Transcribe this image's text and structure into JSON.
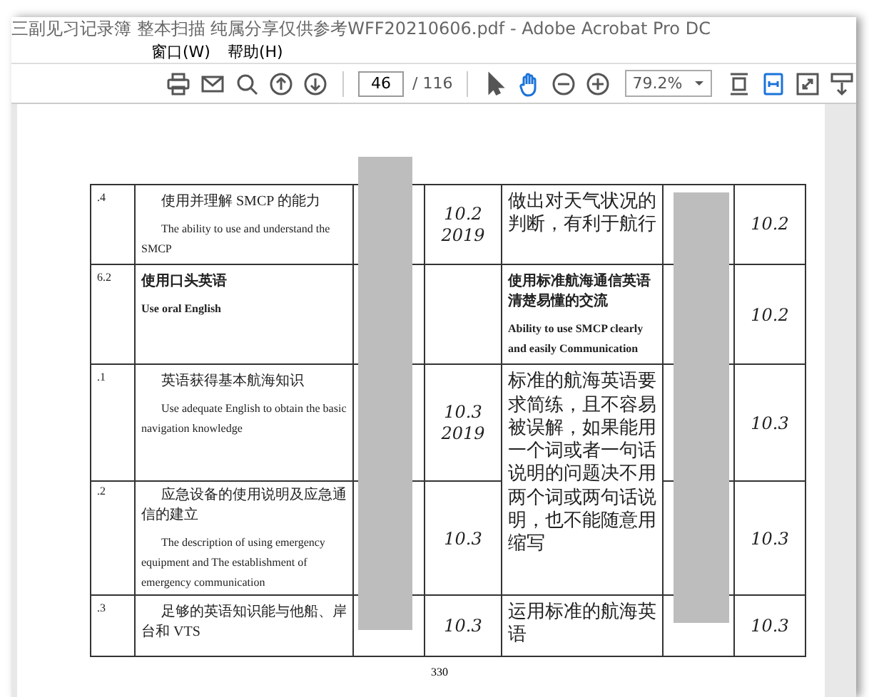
{
  "window": {
    "title": "三副见习记录簿  整本扫描  纯属分享仅供参考WFF20210606.pdf - Adobe Acrobat Pro DC"
  },
  "menu": [
    "窗口(W)",
    "帮助(H)"
  ],
  "toolbar": {
    "tools_left": [
      {
        "kind": "print",
        "selected": false
      },
      {
        "kind": "mail",
        "selected": false
      },
      {
        "kind": "search",
        "selected": false
      },
      {
        "kind": "up",
        "selected": false
      },
      {
        "kind": "down",
        "selected": false
      }
    ],
    "page": {
      "value": "46",
      "total": "/ 116"
    },
    "tools_mid": [
      {
        "kind": "pointer",
        "selected": false
      },
      {
        "kind": "hand",
        "selected": true
      },
      {
        "kind": "zoom-out",
        "selected": false
      },
      {
        "kind": "zoom-in",
        "selected": false
      }
    ],
    "zoom": "79.2%",
    "tools_right": [
      {
        "kind": "fit-page",
        "selected": false
      },
      {
        "kind": "fit-width",
        "selected": true
      },
      {
        "kind": "full-screen",
        "selected": false
      },
      {
        "kind": "scroll",
        "selected": false
      }
    ]
  },
  "document": {
    "rows": [
      {
        "kind": "item",
        "number": ".4",
        "cn": "使用并理解 SMCP 的能力",
        "en": "The ability to use and understand the SMCP",
        "date": [
          "10.2",
          "2019"
        ],
        "note": "做出对天气状况的判断，有利于航行",
        "col7": "10.2"
      },
      {
        "kind": "section",
        "number": "6.2",
        "cn": "使用口头英语",
        "en": "Use oral English",
        "note_cn": "使用标准航海通信英语清楚易懂的交流",
        "note_en": "Ability to use SMCP clearly and easily Communication",
        "col7": "10.2"
      },
      {
        "kind": "item",
        "number": ".1",
        "cn": "英语获得基本航海知识",
        "en": "Use adequate English to obtain the basic navigation knowledge",
        "date": [
          "10.3",
          "2019"
        ],
        "note": "标准的航海英语要求简练，且不容易被误解，如果能用一个词或者一句话说明的问题决不用两个词或两句话说明，也不能随意用缩写",
        "note_spans_next": true,
        "col7": "10.3"
      },
      {
        "kind": "item",
        "number": ".2",
        "cn": "应急设备的使用说明及应急通信的建立",
        "en": "The description of using emergency equipment and The establishment of emergency communication",
        "date": [
          "10.3"
        ],
        "col7": "10.3"
      },
      {
        "kind": "item",
        "number": ".3",
        "cn": "足够的英语知识能与他船、岸台和 VTS",
        "date": [
          "10.3"
        ],
        "note": "运用标准的航海英语",
        "col7": "10.3"
      }
    ],
    "page_number": "330"
  }
}
